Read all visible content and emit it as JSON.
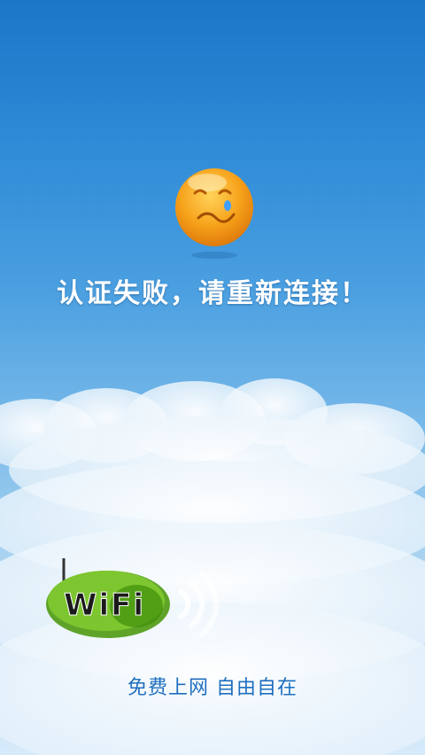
{
  "screen": {
    "message": "认证失败，请重新连接！",
    "icon": "sad-face-icon",
    "colors": {
      "sky_top": "#1b76c8",
      "sky_bottom": "#d6eafa",
      "face": "#f7a21b",
      "wifi_green": "#7dc62f"
    }
  },
  "brand": {
    "logo_text": "WiFi",
    "slogan": "免费上网  自由自在"
  }
}
